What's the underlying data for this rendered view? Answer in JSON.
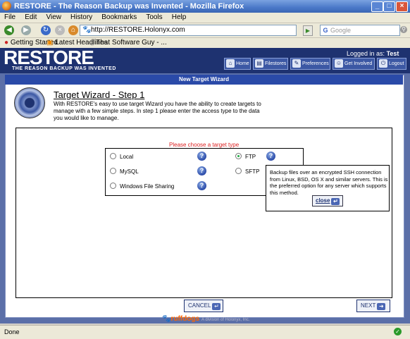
{
  "window": {
    "title": "RESTORE - The Reason Backup was Invented - Mozilla Firefox"
  },
  "menu": [
    "File",
    "Edit",
    "View",
    "History",
    "Bookmarks",
    "Tools",
    "Help"
  ],
  "nav": {
    "url": "http://RESTORE.Holonyx.com",
    "search_placeholder": "Google",
    "search_engine_label": "G"
  },
  "bookmarks": [
    "Getting Started",
    "Latest Headlines",
    "That Software Guy - ..."
  ],
  "app": {
    "logo": "RESTORE",
    "tagline": "THE REASON BACKUP WAS INVENTED",
    "logged_in_label": "Logged in as:",
    "user": "Test User",
    "nav_items": [
      "Home",
      "Filestores",
      "Preferences",
      "Get Involved",
      "Logout"
    ]
  },
  "wizard": {
    "header": "New Target Wizard",
    "step_title": "Target Wizard - Step 1",
    "description": "With RESTORE's easy to use target Wizard you have the ability to create targets to manage with a few simple steps. In step 1 please enter the access type to the data you would like to manage.",
    "prompt": "Please choose a target type",
    "options": [
      {
        "label": "Local",
        "selected": false
      },
      {
        "label": "MySQL",
        "selected": false
      },
      {
        "label": "Windows File Sharing",
        "selected": false
      },
      {
        "label": "FTP",
        "selected": true
      },
      {
        "label": "SFTP",
        "selected": false
      }
    ],
    "tooltip": "Backup files over an encrypted SSH connection from Linux, BSD, OS X and similar servers. This is the preferred option for any server which supports this method.",
    "close_label": "close",
    "cancel_label": "CANCEL",
    "next_label": "NEXT"
  },
  "footer": {
    "brand": "ruffdogs",
    "sub": "A division of Holonyx, Inc."
  },
  "status": {
    "text": "Done"
  },
  "colors": {
    "header_bg": "#1e3270",
    "page_bg": "#5b6fa8",
    "prompt": "#dd2222",
    "footer_brand": "#ff6600"
  }
}
